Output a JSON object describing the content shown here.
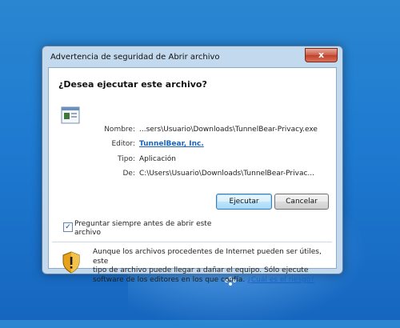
{
  "window": {
    "title": "Advertencia de seguridad de Abrir archivo"
  },
  "question": "¿Desea ejecutar este archivo?",
  "file_info": {
    "name_label": "Nombre:",
    "name_value": "...sers\\Usuario\\Downloads\\TunnelBear-Privacy.exe",
    "publisher_label": "Editor:",
    "publisher_value": "TunnelBear, Inc.",
    "type_label": "Tipo:",
    "type_value": "Aplicación",
    "from_label": "De:",
    "from_value": "C:\\Users\\Usuario\\Downloads\\TunnelBear-Privac..."
  },
  "buttons": {
    "run": "Ejecutar",
    "cancel": "Cancelar",
    "close": "x"
  },
  "checkbox": {
    "label_line1": "Preguntar siempre antes de abrir este",
    "label_line2": "archivo",
    "checked": true,
    "mark": "✓"
  },
  "warning": {
    "line1": "Aunque los archivos procedentes de Internet pueden ser útiles, este",
    "line2": "tipo de archivo puede llegar a dañar el equipo. Sólo ejecute",
    "line3_prefix": "software de los editores en los que confía. ",
    "risk_link": "¿Cuál es el riesgo?"
  },
  "colors": {
    "link": "#1a63c2",
    "desktop": "#1e7ad0",
    "shield": "#e8a21a"
  },
  "icons": [
    "close-icon",
    "application-file-icon",
    "warning-shield-icon",
    "checkmark-icon"
  ]
}
